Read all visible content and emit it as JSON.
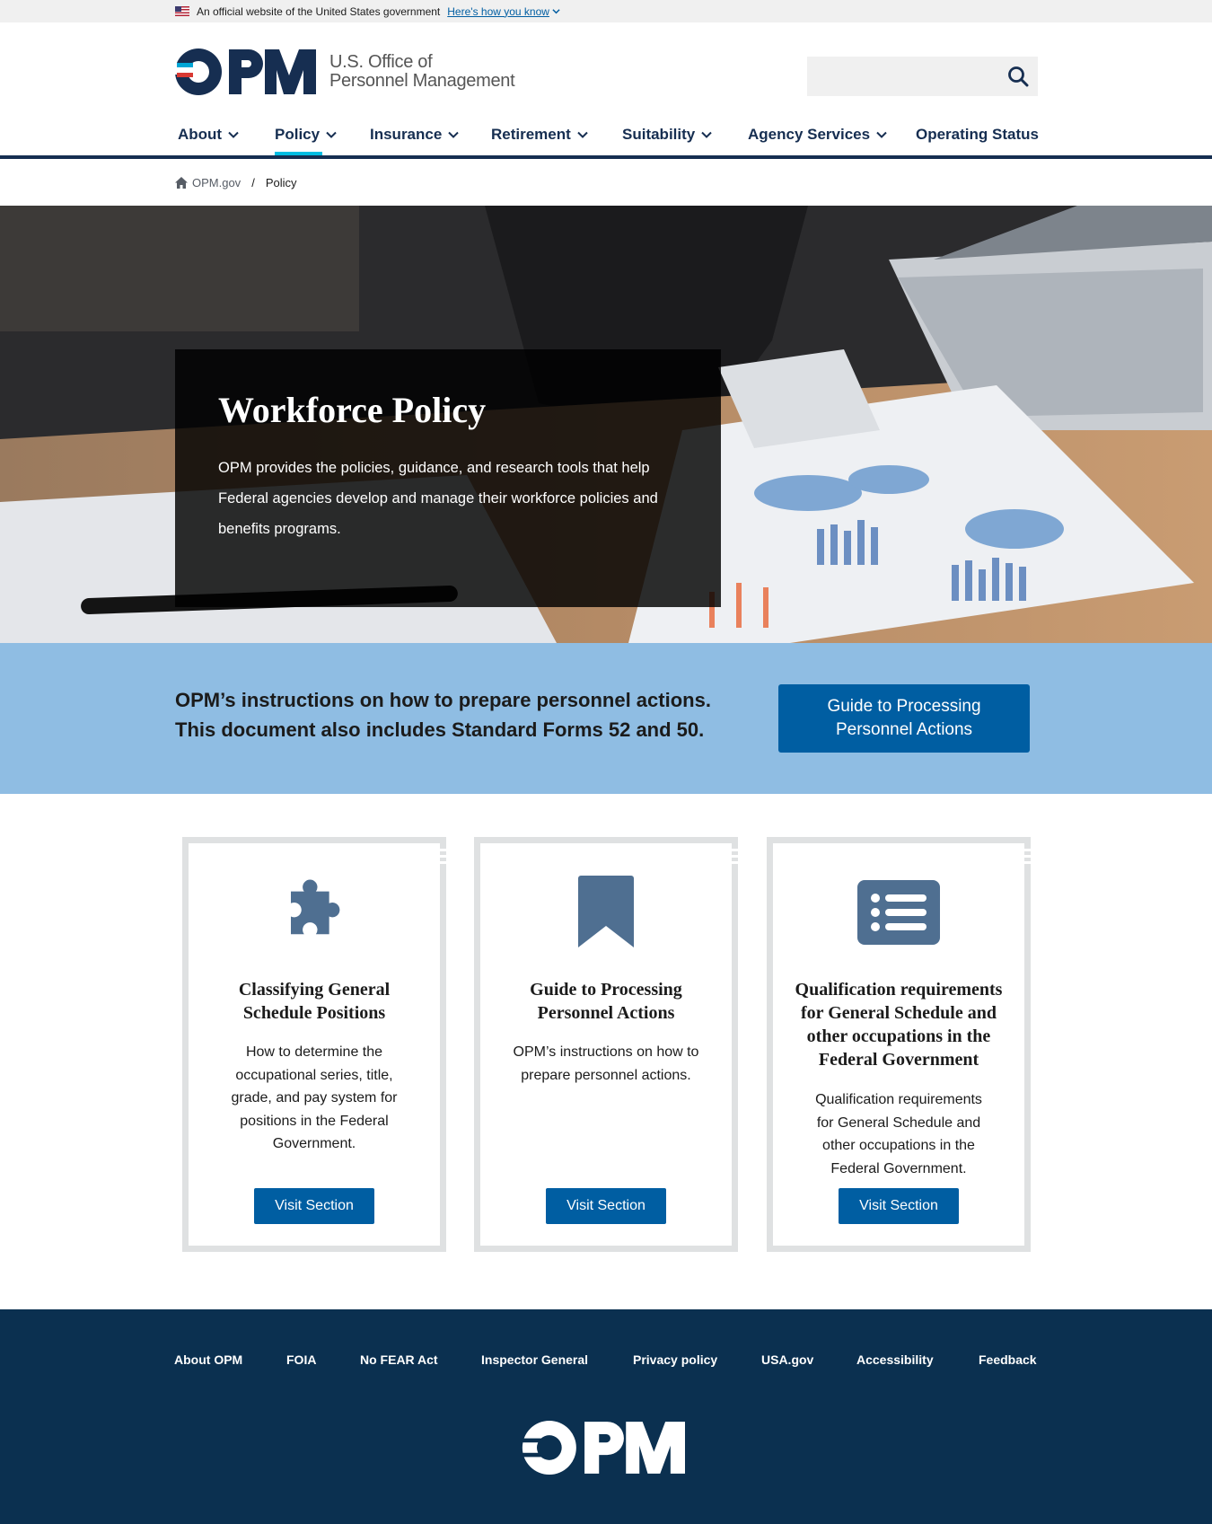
{
  "gov_banner": {
    "official_text": "An official website of the United States government",
    "how_you_know": "Here's how you know"
  },
  "header": {
    "logo_text": "OPM",
    "agency_line1": "U.S. Office of",
    "agency_line2": "Personnel Management",
    "search_placeholder": "",
    "search_icon": "search-icon"
  },
  "nav": {
    "items": [
      {
        "label": "About",
        "dropdown": true
      },
      {
        "label": "Policy",
        "dropdown": true,
        "active": true
      },
      {
        "label": "Insurance",
        "dropdown": true
      },
      {
        "label": "Retirement",
        "dropdown": true
      },
      {
        "label": "Suitability",
        "dropdown": true
      },
      {
        "label": "Agency Services",
        "dropdown": true
      },
      {
        "label": "Operating Status",
        "dropdown": false
      }
    ]
  },
  "breadcrumb": {
    "home": "OPM.gov",
    "separator": "/",
    "current": "Policy"
  },
  "hero": {
    "title": "Workforce Policy",
    "description": "OPM provides the policies, guidance, and research tools that help Federal agencies develop and manage their workforce policies and benefits programs."
  },
  "callout": {
    "text": "OPM’s instructions on how to prepare personnel actions. This document also includes Standard Forms 52 and 50.",
    "button": "Guide to Processing Personnel Actions"
  },
  "cards": [
    {
      "icon": "puzzle-piece-icon",
      "title": "Classifying General Schedule Positions",
      "description": "How to determine the occupational series, title, grade, and pay system for positions in the Federal Government.",
      "button": "Visit Section"
    },
    {
      "icon": "bookmark-icon",
      "title": "Guide to Processing Personnel Actions",
      "description": "OPM’s instructions on how to prepare personnel actions.",
      "button": "Visit Section"
    },
    {
      "icon": "list-icon",
      "title": "Qualification requirements for General Schedule and other occupations in the Federal Government",
      "description": "Qualification requirements for General Schedule and other occupations in the Federal Government.",
      "button": "Visit Section"
    }
  ],
  "footer": {
    "links": [
      "About OPM",
      "FOIA",
      "No FEAR Act",
      "Inspector General",
      "Privacy policy",
      "USA.gov",
      "Accessibility",
      "Feedback"
    ],
    "logo_text": "OPM"
  },
  "colors": {
    "primary_blue": "#005ea2",
    "navy": "#162e51",
    "footer_navy": "#0b3050",
    "callout_blue": "#8fbde3",
    "nav_active": "#00bde3",
    "icon_slate": "#4f6f91"
  }
}
